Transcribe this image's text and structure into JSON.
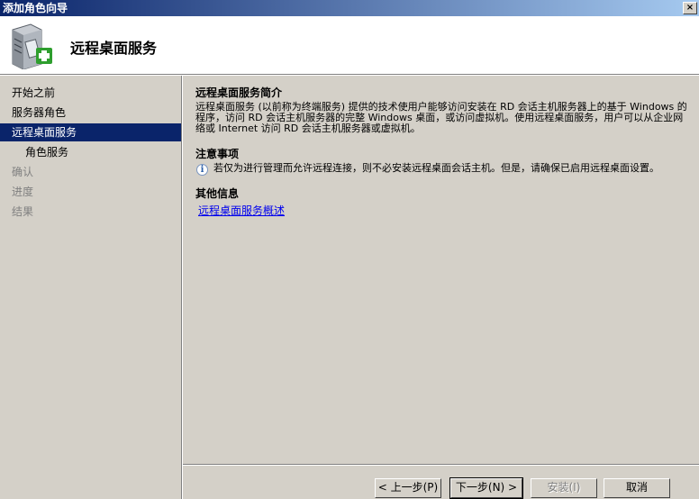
{
  "window": {
    "title": "添加角色向导",
    "close_glyph": "×"
  },
  "header": {
    "title": "远程桌面服务",
    "icon": "server-add-icon"
  },
  "nav": {
    "items": [
      {
        "label": "开始之前"
      },
      {
        "label": "服务器角色"
      },
      {
        "label": "远程桌面服务"
      },
      {
        "label": "角色服务"
      },
      {
        "label": "确认"
      },
      {
        "label": "进度"
      },
      {
        "label": "结果"
      }
    ]
  },
  "content": {
    "intro_title": "远程桌面服务简介",
    "intro_text": "远程桌面服务 (以前称为终端服务) 提供的技术使用户能够访问安装在 RD 会话主机服务器上的基于 Windows 的程序，访问 RD 会话主机服务器的完整 Windows 桌面，或访问虚拟机。使用远程桌面服务，用户可以从企业网络或 Internet 访问 RD 会话主机服务器或虚拟机。",
    "notes_title": "注意事项",
    "note_text": "若仅为进行管理而允许远程连接，则不必安装远程桌面会话主机。但是，请确保已启用远程桌面设置。",
    "more_title": "其他信息",
    "link_text": "远程桌面服务概述"
  },
  "buttons": {
    "prev": "< 上一步(P)",
    "next": "下一步(N) >",
    "install": "安装(I)",
    "cancel": "取消"
  }
}
